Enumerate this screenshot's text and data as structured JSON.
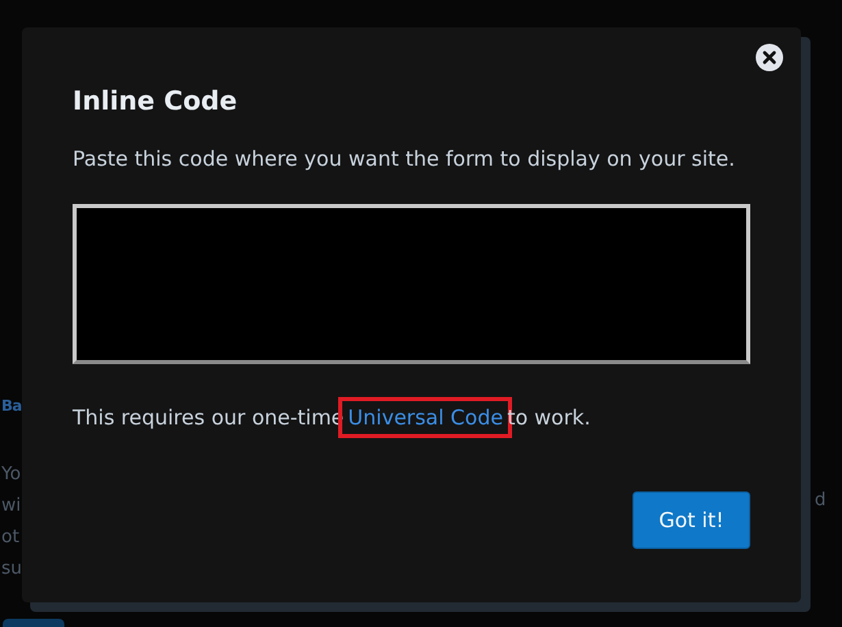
{
  "background": {
    "heading": "Ba",
    "lines": [
      "Yo",
      "wi",
      "ot",
      "su"
    ],
    "side_text": "d"
  },
  "dialog": {
    "title": "Inline Code",
    "instruction": "Paste this code where you want the form to display on your site.",
    "note_before": "This requires our one-time",
    "note_link": "Universal Code",
    "note_after": "to work.",
    "link_highlighted": true,
    "button": "Got it!"
  }
}
